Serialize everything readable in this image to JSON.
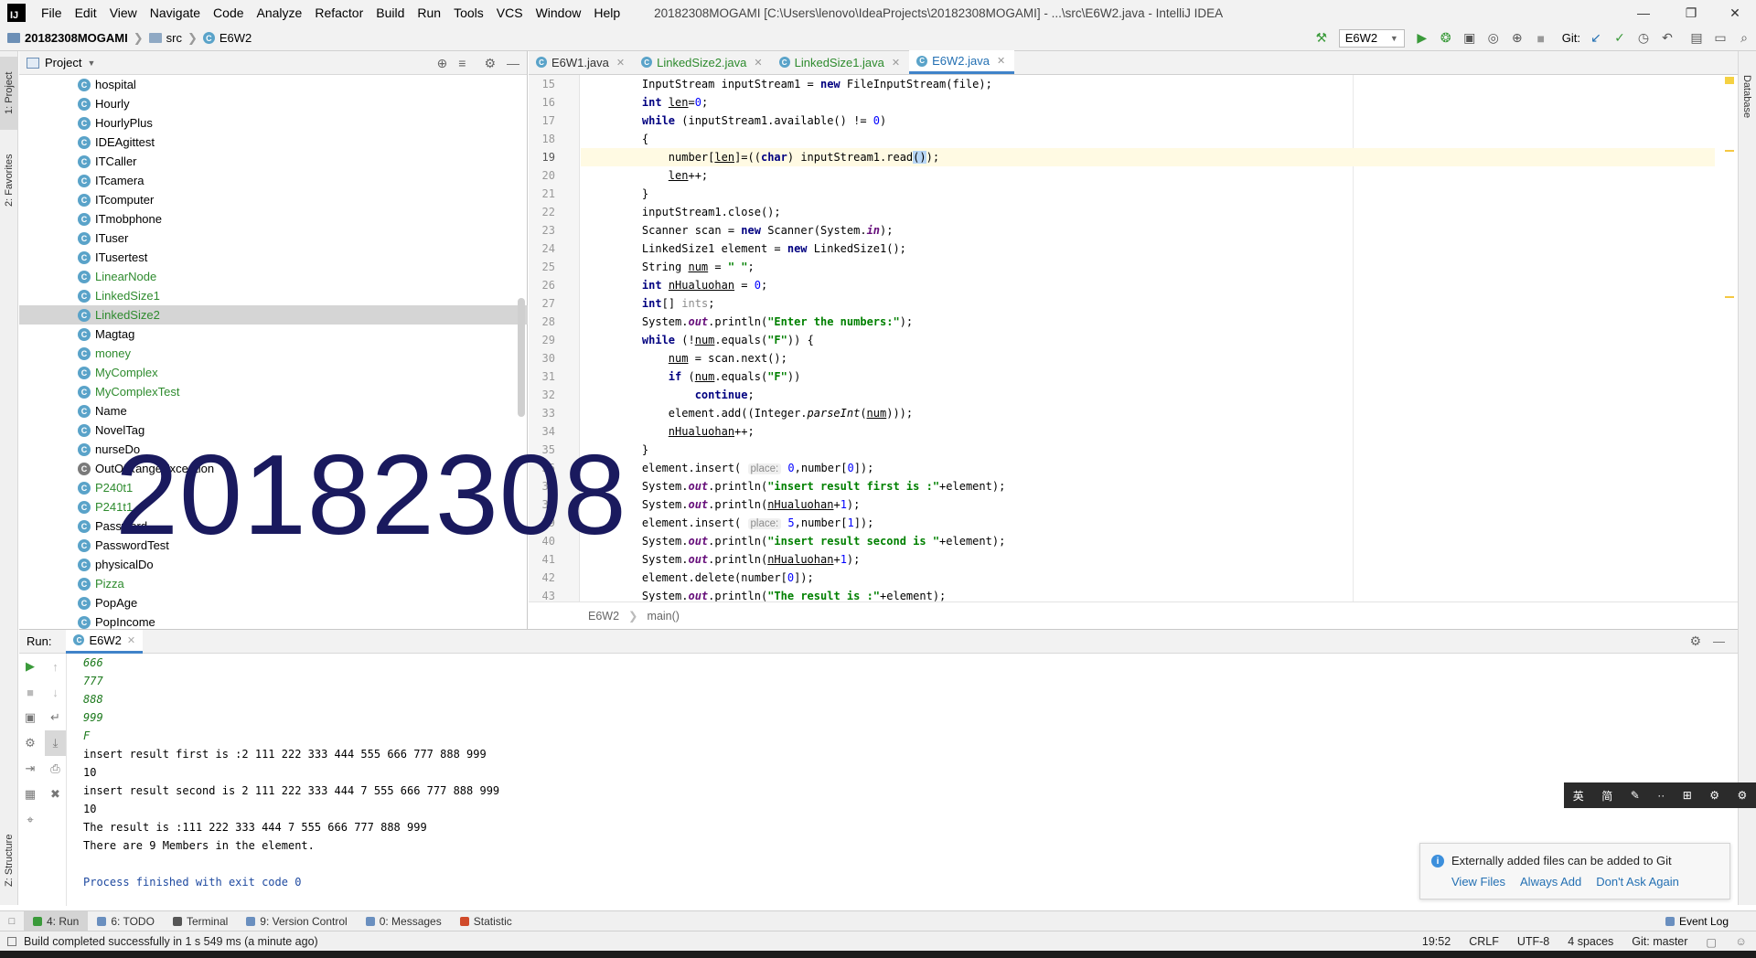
{
  "menubar": {
    "logo": "IJ",
    "items": [
      "File",
      "Edit",
      "View",
      "Navigate",
      "Code",
      "Analyze",
      "Refactor",
      "Build",
      "Run",
      "Tools",
      "VCS",
      "Window",
      "Help"
    ],
    "window_title": "20182308MOGAMI [C:\\Users\\lenovo\\IdeaProjects\\20182308MOGAMI] - ...\\src\\E6W2.java - IntelliJ IDEA"
  },
  "navbar": {
    "project": "20182308MOGAMI",
    "folder": "src",
    "file": "E6W2",
    "run_config": "E6W2",
    "git_label": "Git:"
  },
  "left_stripe": {
    "tab1": "1: Project",
    "tab2": "2: Favorites",
    "tab3": "Z: Structure"
  },
  "right_stripe": {
    "tab1": "Database"
  },
  "project_panel": {
    "title": "Project",
    "items": [
      {
        "name": "hospital",
        "green": false
      },
      {
        "name": "Hourly",
        "green": false
      },
      {
        "name": "HourlyPlus",
        "green": false
      },
      {
        "name": "IDEAgittest",
        "green": false
      },
      {
        "name": "ITCaller",
        "green": false
      },
      {
        "name": "ITcamera",
        "green": false
      },
      {
        "name": "ITcomputer",
        "green": false
      },
      {
        "name": "ITmobphone",
        "green": false
      },
      {
        "name": "ITuser",
        "green": false
      },
      {
        "name": "ITusertest",
        "green": false
      },
      {
        "name": "LinearNode",
        "green": true
      },
      {
        "name": "LinkedSize1",
        "green": true
      },
      {
        "name": "LinkedSize2",
        "green": true
      },
      {
        "name": "Magtag",
        "green": false
      },
      {
        "name": "money",
        "green": true
      },
      {
        "name": "MyComplex",
        "green": true
      },
      {
        "name": "MyComplexTest",
        "green": true
      },
      {
        "name": "Name",
        "green": false
      },
      {
        "name": "NovelTag",
        "green": false
      },
      {
        "name": "nurseDo",
        "green": false
      },
      {
        "name": "OutOfRangeException",
        "green": false
      },
      {
        "name": "P240t1",
        "green": true
      },
      {
        "name": "P241t1",
        "green": true
      },
      {
        "name": "Password",
        "green": false
      },
      {
        "name": "PasswordTest",
        "green": false
      },
      {
        "name": "physicalDo",
        "green": false
      },
      {
        "name": "Pizza",
        "green": true
      },
      {
        "name": "PopAge",
        "green": false
      },
      {
        "name": "PopIncome",
        "green": false
      }
    ]
  },
  "watermark": "20182308",
  "editor": {
    "tabs": [
      {
        "label": "E6W1.java",
        "green": false,
        "active": false
      },
      {
        "label": "LinkedSize2.java",
        "green": true,
        "active": false
      },
      {
        "label": "LinkedSize1.java",
        "green": true,
        "active": false
      },
      {
        "label": "E6W2.java",
        "green": true,
        "active": true
      }
    ],
    "line_numbers": [
      "15",
      "16",
      "17",
      "18",
      "19",
      "20",
      "21",
      "22",
      "23",
      "24",
      "25",
      "26",
      "27",
      "28",
      "29",
      "30",
      "31",
      "32",
      "33",
      "34",
      "35",
      "36",
      "37",
      "38",
      "39",
      "40",
      "41",
      "42",
      "43"
    ],
    "breadcrumb_class": "E6W2",
    "breadcrumb_method": "main()"
  },
  "run_panel": {
    "label": "Run:",
    "tab": "E6W2",
    "input_lines": [
      "666",
      "777",
      "888",
      "999",
      "F"
    ],
    "output_lines": [
      "insert result first is :2 111 222 333 444 555 666 777 888 999",
      "10",
      "insert result second is 2 111 222 333 444 7 555 666 777 888 999",
      "10",
      "The result is :111 222 333 444 7 555 666 777 888 999",
      "There are 9 Members in the element."
    ],
    "exit_line": "Process finished with exit code 0"
  },
  "notification": {
    "title": "Externally added files can be added to Git",
    "actions": [
      "View Files",
      "Always Add",
      "Don't Ask Again"
    ]
  },
  "ime_bar": [
    "英",
    "简",
    "✎",
    "··",
    "⊞",
    "⚙",
    "⚙"
  ],
  "tool_tabs": [
    {
      "label": "4: Run",
      "active": true,
      "color": "#3a9a3a"
    },
    {
      "label": "6: TODO",
      "active": false,
      "color": "#6a8fbf"
    },
    {
      "label": "Terminal",
      "active": false,
      "color": "#555555"
    },
    {
      "label": "9: Version Control",
      "active": false,
      "color": "#6a8fbf"
    },
    {
      "label": "0: Messages",
      "active": false,
      "color": "#6a8fbf"
    },
    {
      "label": "Statistic",
      "active": false,
      "color": "#d04a2a"
    }
  ],
  "event_log": "Event Log",
  "status_bar": {
    "message": "Build completed successfully in 1 s 549 ms (a minute ago)",
    "position": "19:52",
    "line_sep": "CRLF",
    "encoding": "UTF-8",
    "indent": "4 spaces",
    "git": "Git: master"
  }
}
